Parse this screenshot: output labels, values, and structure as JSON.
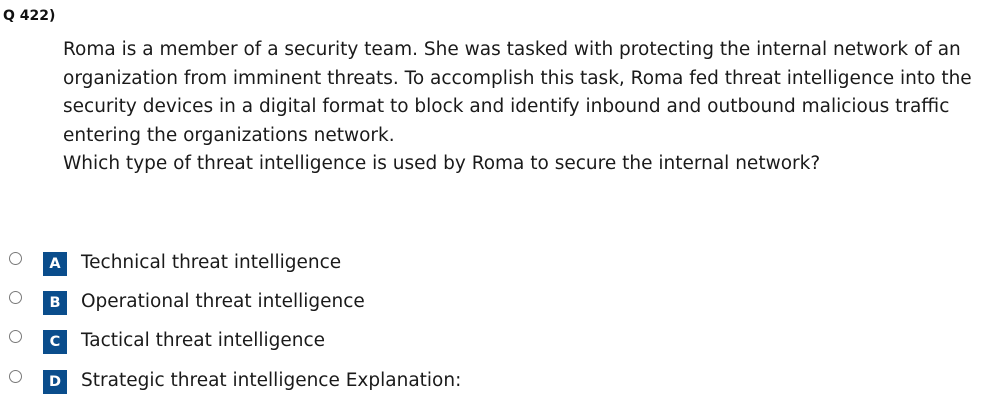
{
  "question": {
    "number": "Q 422)",
    "lines": [
      "Roma is a member of a security team. She was tasked with protecting the internal network of an",
      "organization from imminent threats. To accomplish this task, Roma fed threat intelligence into the",
      "security devices in a digital format to block and identify inbound and outbound malicious traffic",
      "entering the organizations network.",
      "Which type of threat intelligence is used by Roma to secure the internal network?"
    ]
  },
  "options": [
    {
      "letter": "A",
      "label": "Technical threat intelligence"
    },
    {
      "letter": "B",
      "label": "Operational threat intelligence"
    },
    {
      "letter": "C",
      "label": "Tactical threat intelligence"
    },
    {
      "letter": "D",
      "label": "Strategic threat intelligence Explanation:"
    }
  ],
  "colors": {
    "letter_badge": "#0a4d8c",
    "text": "#1a1a1a"
  }
}
